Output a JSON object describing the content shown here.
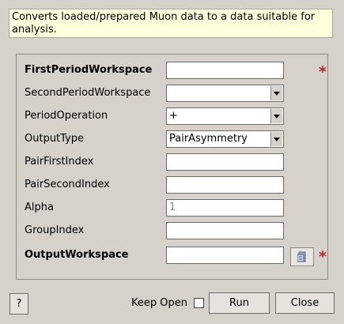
{
  "description": "Converts loaded/prepared Muon data to a data suitable for analysis.",
  "fields": [
    {
      "label": "FirstPeriodWorkspace",
      "bold": true,
      "value": "",
      "required": true
    },
    {
      "label": "SecondPeriodWorkspace",
      "value": ""
    },
    {
      "label": "PeriodOperation",
      "value": "+"
    },
    {
      "label": "OutputType",
      "value": "PairAsymmetry"
    },
    {
      "label": "PairFirstIndex",
      "value": ""
    },
    {
      "label": "PairSecondIndex",
      "value": ""
    },
    {
      "label": "Alpha",
      "value": "1"
    },
    {
      "label": "GroupIndex",
      "value": ""
    },
    {
      "label": "OutputWorkspace",
      "bold": true,
      "value": "",
      "required": true
    }
  ],
  "required_marker": "*",
  "footer": {
    "help_label": "?",
    "keep_open_label": "Keep Open",
    "run_label": "Run",
    "close_label": "Close"
  }
}
